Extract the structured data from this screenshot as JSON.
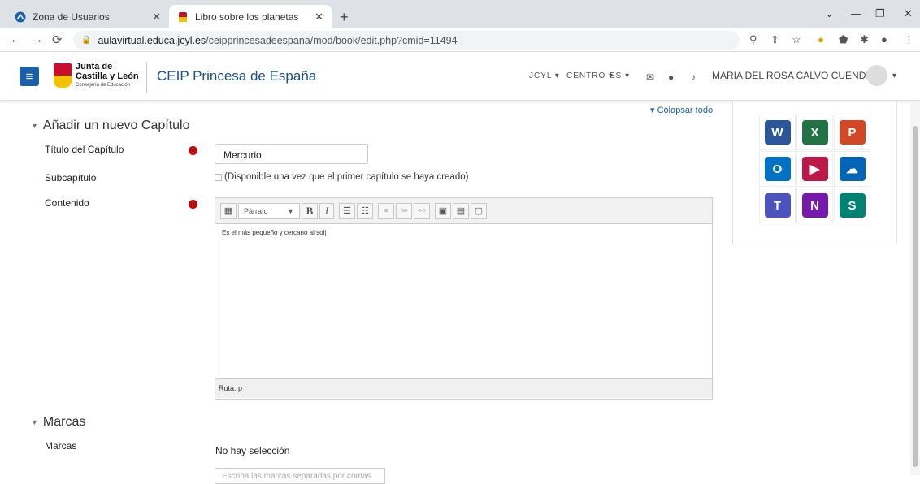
{
  "browser": {
    "tabs": [
      {
        "title": "Zona de Usuarios",
        "icon": "moodle-icon"
      },
      {
        "title": "Libro sobre los planetas",
        "icon": "shield-icon",
        "active": true
      }
    ],
    "url_host": "aulavirtual.educa.jcyl.es",
    "url_path": "/ceipprincesadeespana/mod/book/edit.php?cmid=11494"
  },
  "header": {
    "logo_line1": "Junta de",
    "logo_line2": "Castilla y León",
    "logo_sub": "Consejería de Educación",
    "site_name": "CEIP Princesa de España",
    "nav": [
      "JCYL",
      "CENTRO",
      "ES"
    ],
    "user_name": "MARIA DEL ROSA CALVO CUENDE"
  },
  "form": {
    "collapse_all": "Colapsar todo",
    "section_title": "Añadir un nuevo Capítulo",
    "chapter_title_label": "Título del Capítulo",
    "chapter_title_value": "Mercurio",
    "subchapter_label": "Subcapítulo",
    "subchapter_text": "(Disponible una vez que el primer capítulo se haya creado)",
    "content_label": "Contenido",
    "paragraph_select": "Párrafo",
    "content_text": "Es el más pequeño y cercano al sol",
    "path_text": "Ruta: p",
    "tags_section": "Marcas",
    "tags_label": "Marcas",
    "no_selection": "No hay selección",
    "tags_placeholder": "Escriba las marcas separadas por comas"
  },
  "apps": [
    {
      "name": "word-icon",
      "letter": "W",
      "color": "#2b579a"
    },
    {
      "name": "excel-icon",
      "letter": "X",
      "color": "#217346"
    },
    {
      "name": "powerpoint-icon",
      "letter": "P",
      "color": "#d24726"
    },
    {
      "name": "outlook-icon",
      "letter": "O",
      "color": "#0072c6"
    },
    {
      "name": "stream-icon",
      "letter": "▶",
      "color": "#bc1948"
    },
    {
      "name": "onedrive-icon",
      "letter": "☁",
      "color": "#0364b8"
    },
    {
      "name": "teams-icon",
      "letter": "T",
      "color": "#4b53bc"
    },
    {
      "name": "onenote-icon",
      "letter": "N",
      "color": "#7719aa"
    },
    {
      "name": "sway-icon",
      "letter": "S",
      "color": "#008272"
    }
  ]
}
